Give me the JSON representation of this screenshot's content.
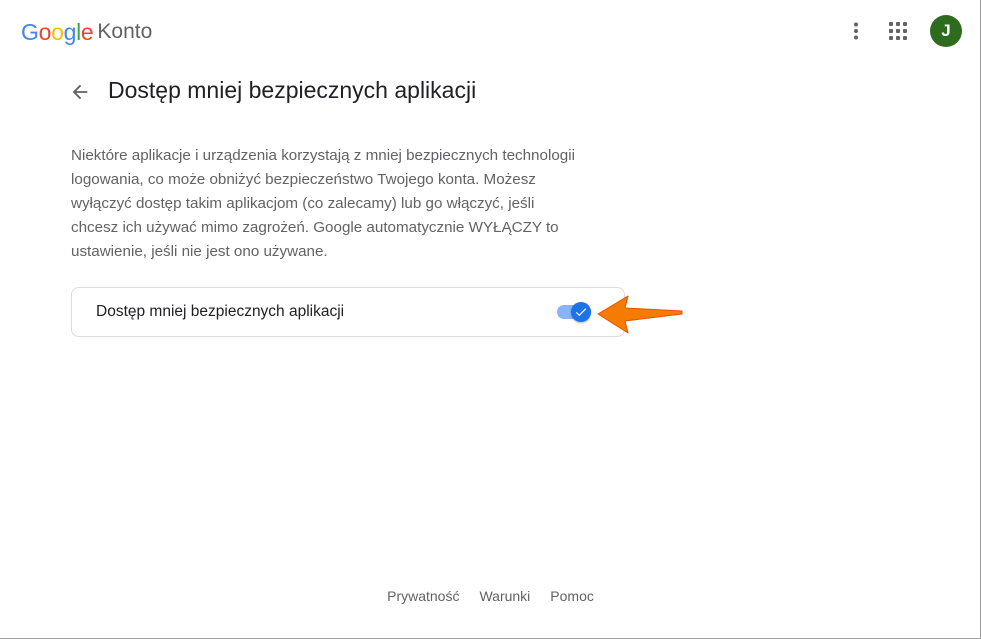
{
  "header": {
    "logo_letters": [
      "G",
      "o",
      "o",
      "g",
      "l",
      "e"
    ],
    "product_name": "Konto",
    "avatar_initial": "J",
    "icons": [
      "more-vert-icon",
      "apps-grid-icon"
    ]
  },
  "page": {
    "title": "Dostęp mniej bezpiecznych aplikacji",
    "description_lines": [
      "Niektóre aplikacje i urządzenia korzystają z mniej bezpiecznych technologii",
      "logowania, co może obniżyć bezpieczeństwo Twojego konta. Możesz",
      "wyłączyć dostęp takim aplikacjom (co zalecamy) lub go włączyć, jeśli",
      "chcesz ich używać mimo zagrożeń. Google automatycznie WYŁĄCZY to",
      "ustawienie, jeśli nie jest ono używane."
    ]
  },
  "setting": {
    "label": "Dostęp mniej bezpiecznych aplikacji",
    "enabled": true
  },
  "footer": {
    "links": [
      "Prywatność",
      "Warunki",
      "Pomoc"
    ]
  },
  "colors": {
    "accent": "#1a73e8",
    "annotation_arrow": "#f57c00",
    "avatar_bg": "#2e6b1f"
  }
}
